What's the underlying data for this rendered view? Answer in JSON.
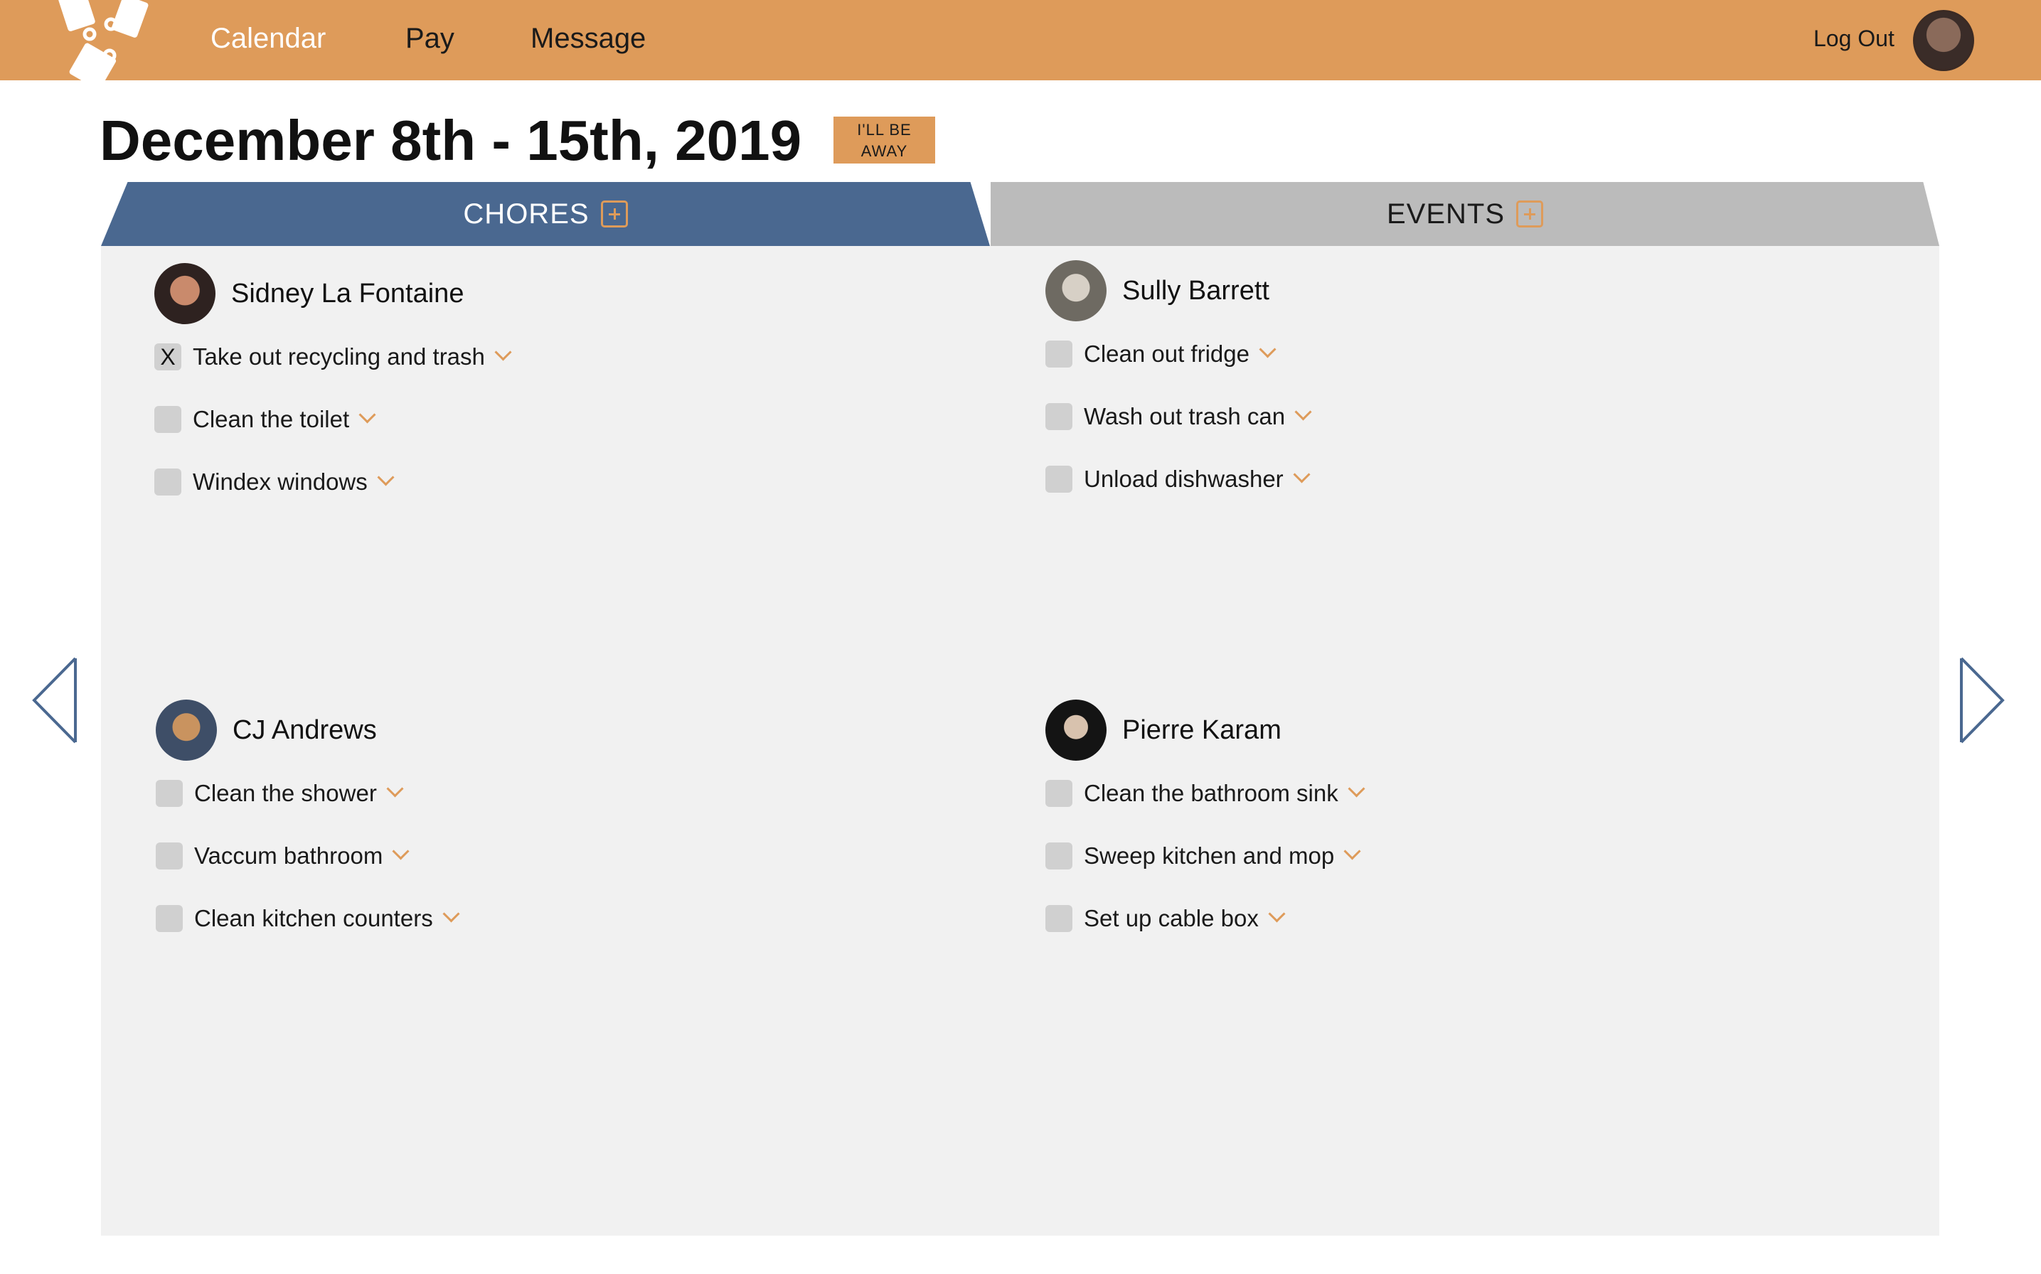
{
  "nav": {
    "links": [
      "Calendar",
      "Pay",
      "Message"
    ],
    "logout": "Log Out"
  },
  "page": {
    "title": "December 8th - 15th, 2019",
    "away_line1": "I'LL BE",
    "away_line2": "AWAY"
  },
  "tabs": {
    "chores": "CHORES",
    "events": "EVENTS"
  },
  "people": [
    {
      "name": "Sidney La Fontaine",
      "chores": [
        {
          "label": "Take out recycling and trash",
          "checked": "X"
        },
        {
          "label": "Clean the toilet",
          "checked": ""
        },
        {
          "label": "Windex windows",
          "checked": ""
        }
      ]
    },
    {
      "name": "Sully Barrett",
      "chores": [
        {
          "label": "Clean out fridge",
          "checked": ""
        },
        {
          "label": "Wash out trash can",
          "checked": ""
        },
        {
          "label": "Unload dishwasher",
          "checked": ""
        }
      ]
    },
    {
      "name": "CJ Andrews",
      "chores": [
        {
          "label": "Clean the shower",
          "checked": ""
        },
        {
          "label": "Vaccum bathroom",
          "checked": ""
        },
        {
          "label": "Clean kitchen counters",
          "checked": ""
        }
      ]
    },
    {
      "name": "Pierre Karam",
      "chores": [
        {
          "label": "Clean the bathroom sink",
          "checked": ""
        },
        {
          "label": "Sweep kitchen and mop",
          "checked": ""
        },
        {
          "label": "Set up cable box",
          "checked": ""
        }
      ]
    }
  ],
  "icons": {
    "logo": "house-logo-icon",
    "chores_add": "plus-box-icon",
    "events_add": "plus-box-icon",
    "prev": "chevron-left-icon",
    "next": "chevron-right-icon",
    "expand": "chevron-down-icon"
  },
  "colors": {
    "accent": "#de9b5a",
    "chores_tab": "#4a6890",
    "events_tab": "#bbbbbb",
    "panel": "#f1f1f1"
  }
}
